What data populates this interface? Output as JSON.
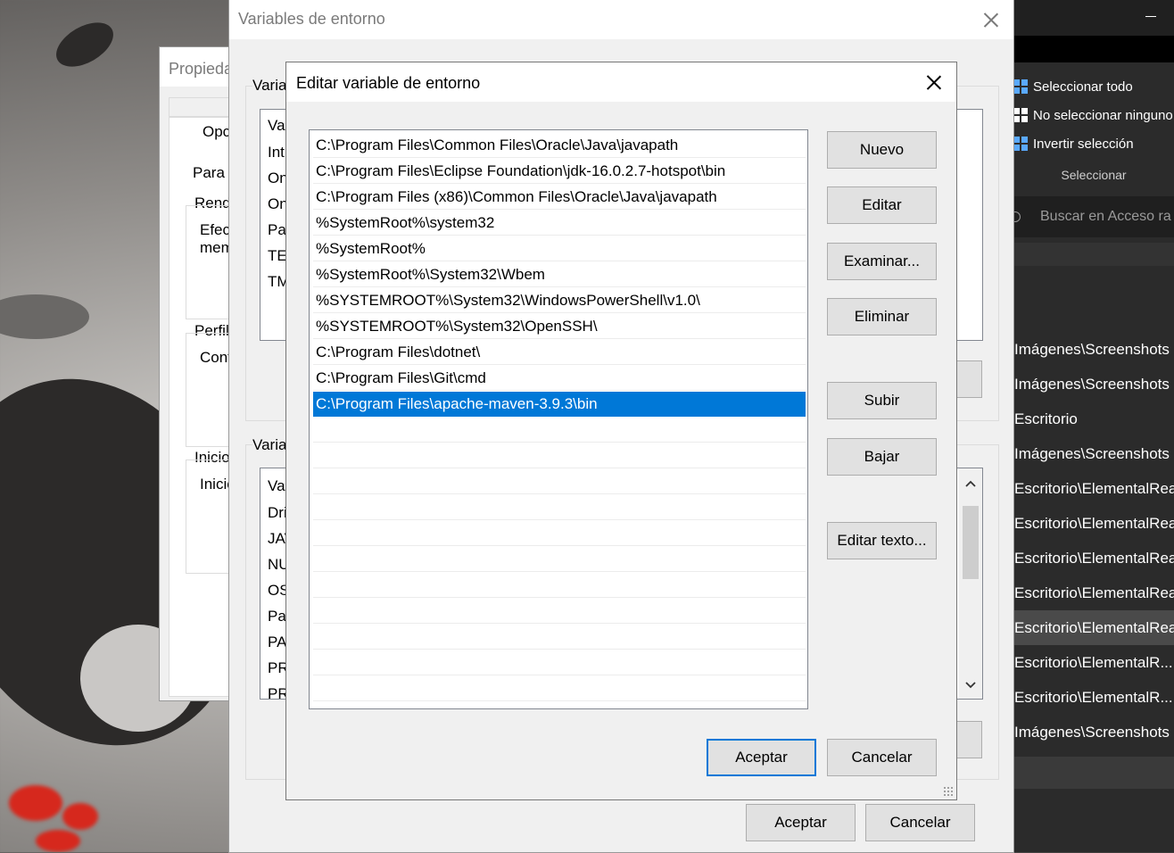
{
  "explorer": {
    "ribbon": {
      "select_all": "Seleccionar todo",
      "select_none": "No seleccionar ninguno",
      "invert": "Invertir selección",
      "group_label": "Seleccionar"
    },
    "search_placeholder": "Buscar en Acceso ra",
    "paths": [
      "Imágenes\\Screenshots",
      "Imágenes\\Screenshots",
      "Escritorio",
      "Imágenes\\Screenshots",
      "Escritorio\\ElementalRea",
      "Escritorio\\ElementalRea",
      "Escritorio\\ElementalRea",
      "Escritorio\\ElementalRea",
      "Escritorio\\ElementalRea",
      "Escritorio\\ElementalR...",
      "Escritorio\\ElementalR...",
      "Imágenes\\Screenshots"
    ]
  },
  "props_window": {
    "title": "Propieda",
    "fragments": [
      "Opc",
      "Para r",
      "Rend",
      "Efec",
      "mem",
      "Perfile",
      "Conf",
      "Inicio",
      "Inicic"
    ]
  },
  "env_window": {
    "title": "Variables de entorno",
    "user_group_label": "Varia",
    "system_group_label": "Varia",
    "user_list": [
      "Var",
      "Int",
      "On",
      "On",
      "Pat",
      "TE",
      "TM"
    ],
    "system_list": [
      "Var",
      "Dri",
      "JAV",
      "NU",
      "OS",
      "Pat",
      "PA",
      "PR",
      "PR"
    ],
    "ok": "Aceptar",
    "cancel": "Cancelar"
  },
  "edit_dialog": {
    "title": "Editar variable de entorno",
    "entries": [
      "C:\\Program Files\\Common Files\\Oracle\\Java\\javapath",
      "C:\\Program Files\\Eclipse Foundation\\jdk-16.0.2.7-hotspot\\bin",
      "C:\\Program Files (x86)\\Common Files\\Oracle\\Java\\javapath",
      "%SystemRoot%\\system32",
      "%SystemRoot%",
      "%SystemRoot%\\System32\\Wbem",
      "%SYSTEMROOT%\\System32\\WindowsPowerShell\\v1.0\\",
      "%SYSTEMROOT%\\System32\\OpenSSH\\",
      "C:\\Program Files\\dotnet\\",
      "C:\\Program Files\\Git\\cmd",
      "C:\\Program Files\\apache-maven-3.9.3\\bin"
    ],
    "selected_index": 10,
    "buttons": {
      "new": "Nuevo",
      "edit": "Editar",
      "browse": "Examinar...",
      "delete": "Eliminar",
      "up": "Subir",
      "down": "Bajar",
      "edit_text": "Editar texto..."
    },
    "ok": "Aceptar",
    "cancel": "Cancelar"
  },
  "colors": {
    "selection": "#0078d7",
    "dialog_bg": "#f0f0f0",
    "explorer_bg": "#2b2b2b"
  }
}
